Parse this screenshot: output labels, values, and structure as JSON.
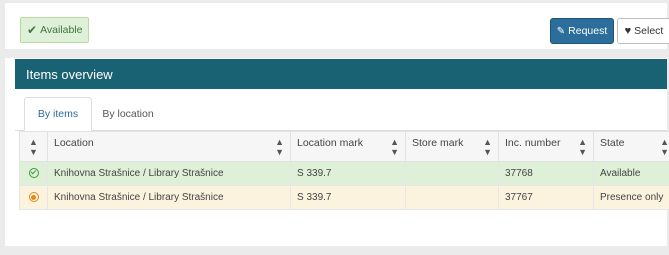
{
  "top": {
    "badge_label": "Available",
    "request_label": "Request",
    "select_label": "Select"
  },
  "panel": {
    "title": "Items overview",
    "tabs": [
      {
        "label": "By items",
        "active": true
      },
      {
        "label": "By location",
        "active": false
      }
    ]
  },
  "table": {
    "columns": [
      "Location",
      "Location mark",
      "Store mark",
      "Inc. number",
      "State"
    ],
    "rows": [
      {
        "status": "available",
        "location": "Knihovna Strašnice / Library Strašnice",
        "location_mark": "S 339.7",
        "store_mark": "",
        "inc_number": "37768",
        "state": "Available"
      },
      {
        "status": "presence",
        "location": "Knihovna Strašnice / Library Strašnice",
        "location_mark": "S 339.7",
        "store_mark": "",
        "inc_number": "37767",
        "state": "Presence only"
      }
    ]
  },
  "colors": {
    "panel_heading": "#196273",
    "request_button": "#2b6d9b",
    "available_row": "#dff0d8",
    "presence_row": "#fcf3df"
  },
  "icons": [
    "check-icon",
    "pencil-icon",
    "heart-icon",
    "sort-icon",
    "available-status-icon",
    "presence-status-icon"
  ]
}
